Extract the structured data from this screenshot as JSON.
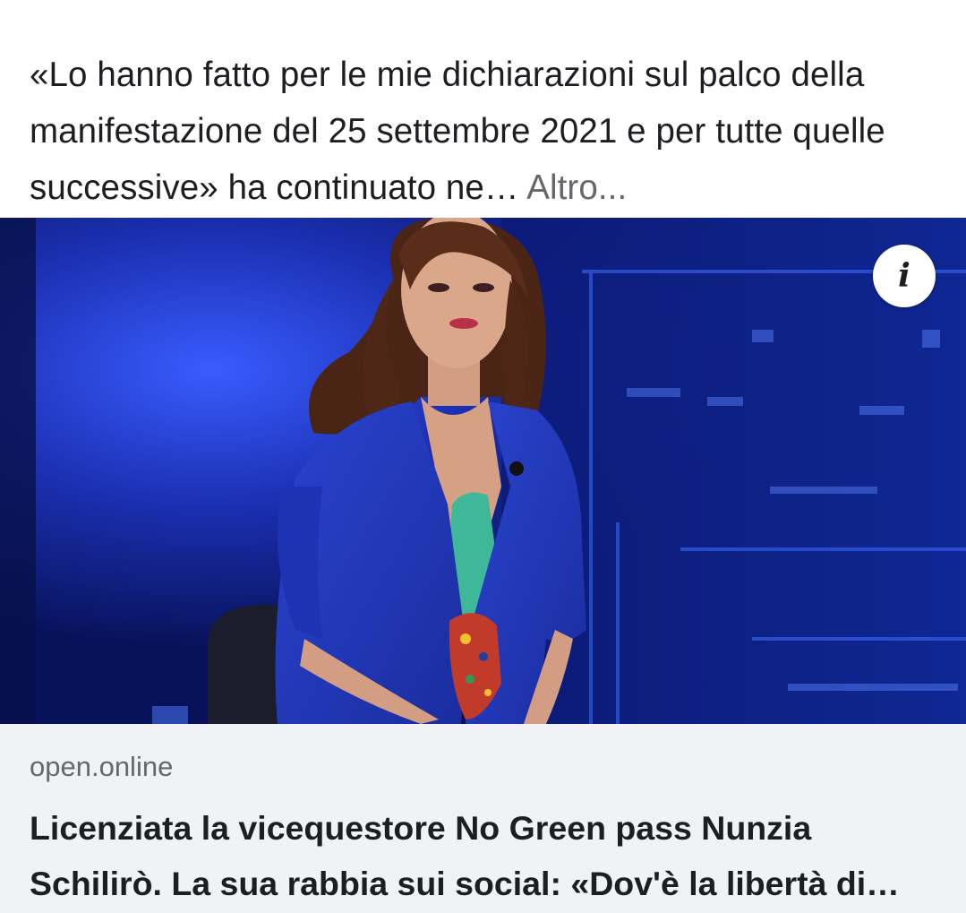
{
  "post": {
    "text": "«Lo hanno fatto per le mie dichiarazioni sul palco della manifestazione del 25 settembre 2021 e per tutte quelle successive» ha continuato ne…",
    "more_label": "Altro..."
  },
  "link_preview": {
    "info_icon": "info-icon",
    "info_glyph": "i",
    "domain": "open.online",
    "headline": "Licenziata la vicequestore No Green pass Nunzia Schilirò. La sua rabbia sui social: «Dov'è la libertà di…"
  },
  "colors": {
    "text_primary": "#1c1e21",
    "text_secondary": "#65676b",
    "caption_bg": "#f0f2f5",
    "studio_blue": "#0b1a6e",
    "jacket_blue": "#2036b8",
    "top_green": "#3fb89a"
  }
}
